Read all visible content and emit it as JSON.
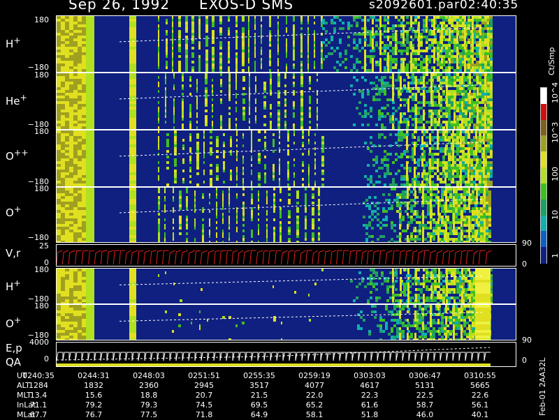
{
  "header": {
    "date": "Sep 26, 1992",
    "instrument": "EXOS-D SMS",
    "file": "s2092601.par",
    "time": "02:40:35"
  },
  "panels": [
    {
      "id": "H+",
      "label": "H",
      "sup": "+",
      "top_tick": "180",
      "bottom_tick": "−180"
    },
    {
      "id": "He+",
      "label": "He",
      "sup": "+",
      "top_tick": "180",
      "bottom_tick": "−180"
    },
    {
      "id": "O++",
      "label": "O",
      "sup": "++",
      "top_tick": "180",
      "bottom_tick": "−180"
    },
    {
      "id": "O+",
      "label": "O",
      "sup": "+",
      "top_tick": "180",
      "bottom_tick": "−180"
    },
    {
      "id": "Vr",
      "label": "V,r",
      "top_tick": "25",
      "bottom_tick": "0",
      "right_top": "90",
      "right_bottom": "0"
    },
    {
      "id": "H+2",
      "label": "H",
      "sup": "+",
      "top_tick": "180",
      "bottom_tick": "−180"
    },
    {
      "id": "O+2",
      "label": "O",
      "sup": "+",
      "top_tick": "180",
      "bottom_tick": "−180"
    },
    {
      "id": "Ep",
      "label": "E,p",
      "label2": "QA",
      "top_tick": "4000",
      "bottom_tick": "0",
      "right_top": "90",
      "right_bottom": "0"
    }
  ],
  "colorbar": {
    "unit": "Ct/Smp",
    "labels": [
      "10^4",
      "10^3",
      "100",
      "10",
      "1"
    ],
    "colors": [
      "#ffffff",
      "#d01010",
      "#806020",
      "#a0a020",
      "#e0e020",
      "#b0e020",
      "#40c020",
      "#20a060",
      "#10b0b0",
      "#1060c0",
      "#102080"
    ]
  },
  "info_table": {
    "row_labels": [
      "UT",
      "ALT",
      "MLT",
      "InLat",
      "MLat"
    ],
    "columns": [
      {
        "UT": "0240:35",
        "ALT": "1284",
        "MLT": "13.4",
        "InLat": "71.1",
        "MLat": "67.7"
      },
      {
        "UT": "0244:31",
        "ALT": "1832",
        "MLT": "15.6",
        "InLat": "79.2",
        "MLat": "76.7"
      },
      {
        "UT": "0248:03",
        "ALT": "2360",
        "MLT": "18.8",
        "InLat": "79.3",
        "MLat": "77.5"
      },
      {
        "UT": "0251:51",
        "ALT": "2945",
        "MLT": "20.7",
        "InLat": "74.5",
        "MLat": "71.8"
      },
      {
        "UT": "0255:35",
        "ALT": "3517",
        "MLT": "21.5",
        "InLat": "69.5",
        "MLat": "64.9"
      },
      {
        "UT": "0259:19",
        "ALT": "4077",
        "MLT": "22.0",
        "InLat": "65.2",
        "MLat": "58.1"
      },
      {
        "UT": "0303:03",
        "ALT": "4617",
        "MLT": "22.3",
        "InLat": "61.6",
        "MLat": "51.8"
      },
      {
        "UT": "0306:47",
        "ALT": "5131",
        "MLT": "22.5",
        "InLat": "58.7",
        "MLat": "46.0"
      },
      {
        "UT": "0310:55",
        "ALT": "5665",
        "MLT": "22.6",
        "InLat": "56.1",
        "MLat": "40.1"
      }
    ],
    "side_note": "Feb-01 2AA32L"
  },
  "chart_data": {
    "type": "heatmap",
    "title": "Sep 26, 1992 EXOS-D SMS",
    "x_tick_labels": [
      "0240:35",
      "0244:31",
      "0248:03",
      "0251:51",
      "0255:35",
      "0259:19",
      "0303:03",
      "0306:47",
      "0310:55"
    ],
    "colorbar_unit": "Ct/Smp",
    "colorbar_labels": [
      "1",
      "10",
      "100",
      "10^3",
      "10^4"
    ],
    "panels": [
      "H+",
      "He+",
      "O++",
      "O+",
      "V,r",
      "H+",
      "O+",
      "E,p QA"
    ],
    "pitch_angle_range": [
      -180,
      180
    ],
    "vr_range": [
      0,
      25
    ],
    "ep_range": [
      0,
      4000
    ]
  }
}
